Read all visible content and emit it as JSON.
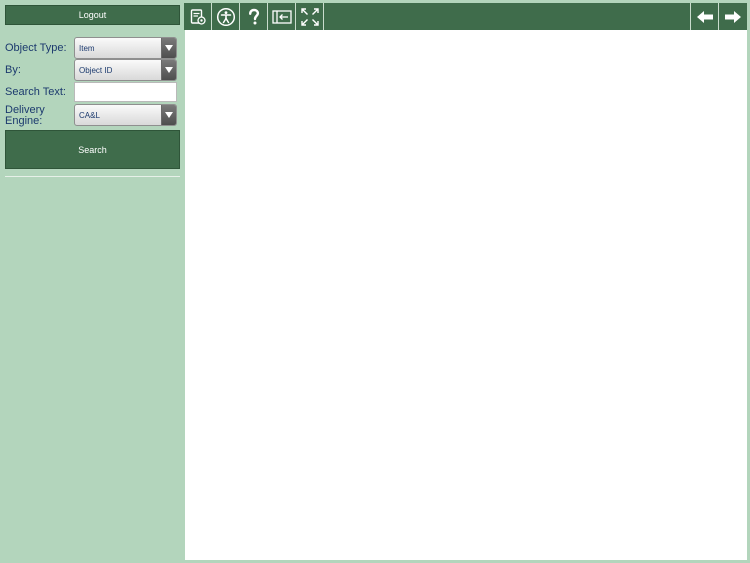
{
  "sidebar": {
    "logout_label": "Logout",
    "fields": {
      "object_type": {
        "label": "Object Type:",
        "value": "Item"
      },
      "by": {
        "label": "By:",
        "value": "Object ID"
      },
      "search_text": {
        "label": "Search Text:",
        "value": ""
      },
      "delivery_engine": {
        "label_line1": "Delivery",
        "label_line2": "Engine:",
        "value": "CA&L"
      }
    },
    "search_label": "Search"
  },
  "toolbar": {
    "icons": [
      "document-settings-icon",
      "accessibility-icon",
      "help-icon",
      "split-view-icon",
      "fullscreen-icon",
      "arrow-left-icon",
      "arrow-right-icon"
    ]
  },
  "colors": {
    "accent": "#3f6c4b",
    "sidebar_bg": "#b3d5bc",
    "label_text": "#1c3a6e",
    "content_bg": "#ffffff"
  }
}
